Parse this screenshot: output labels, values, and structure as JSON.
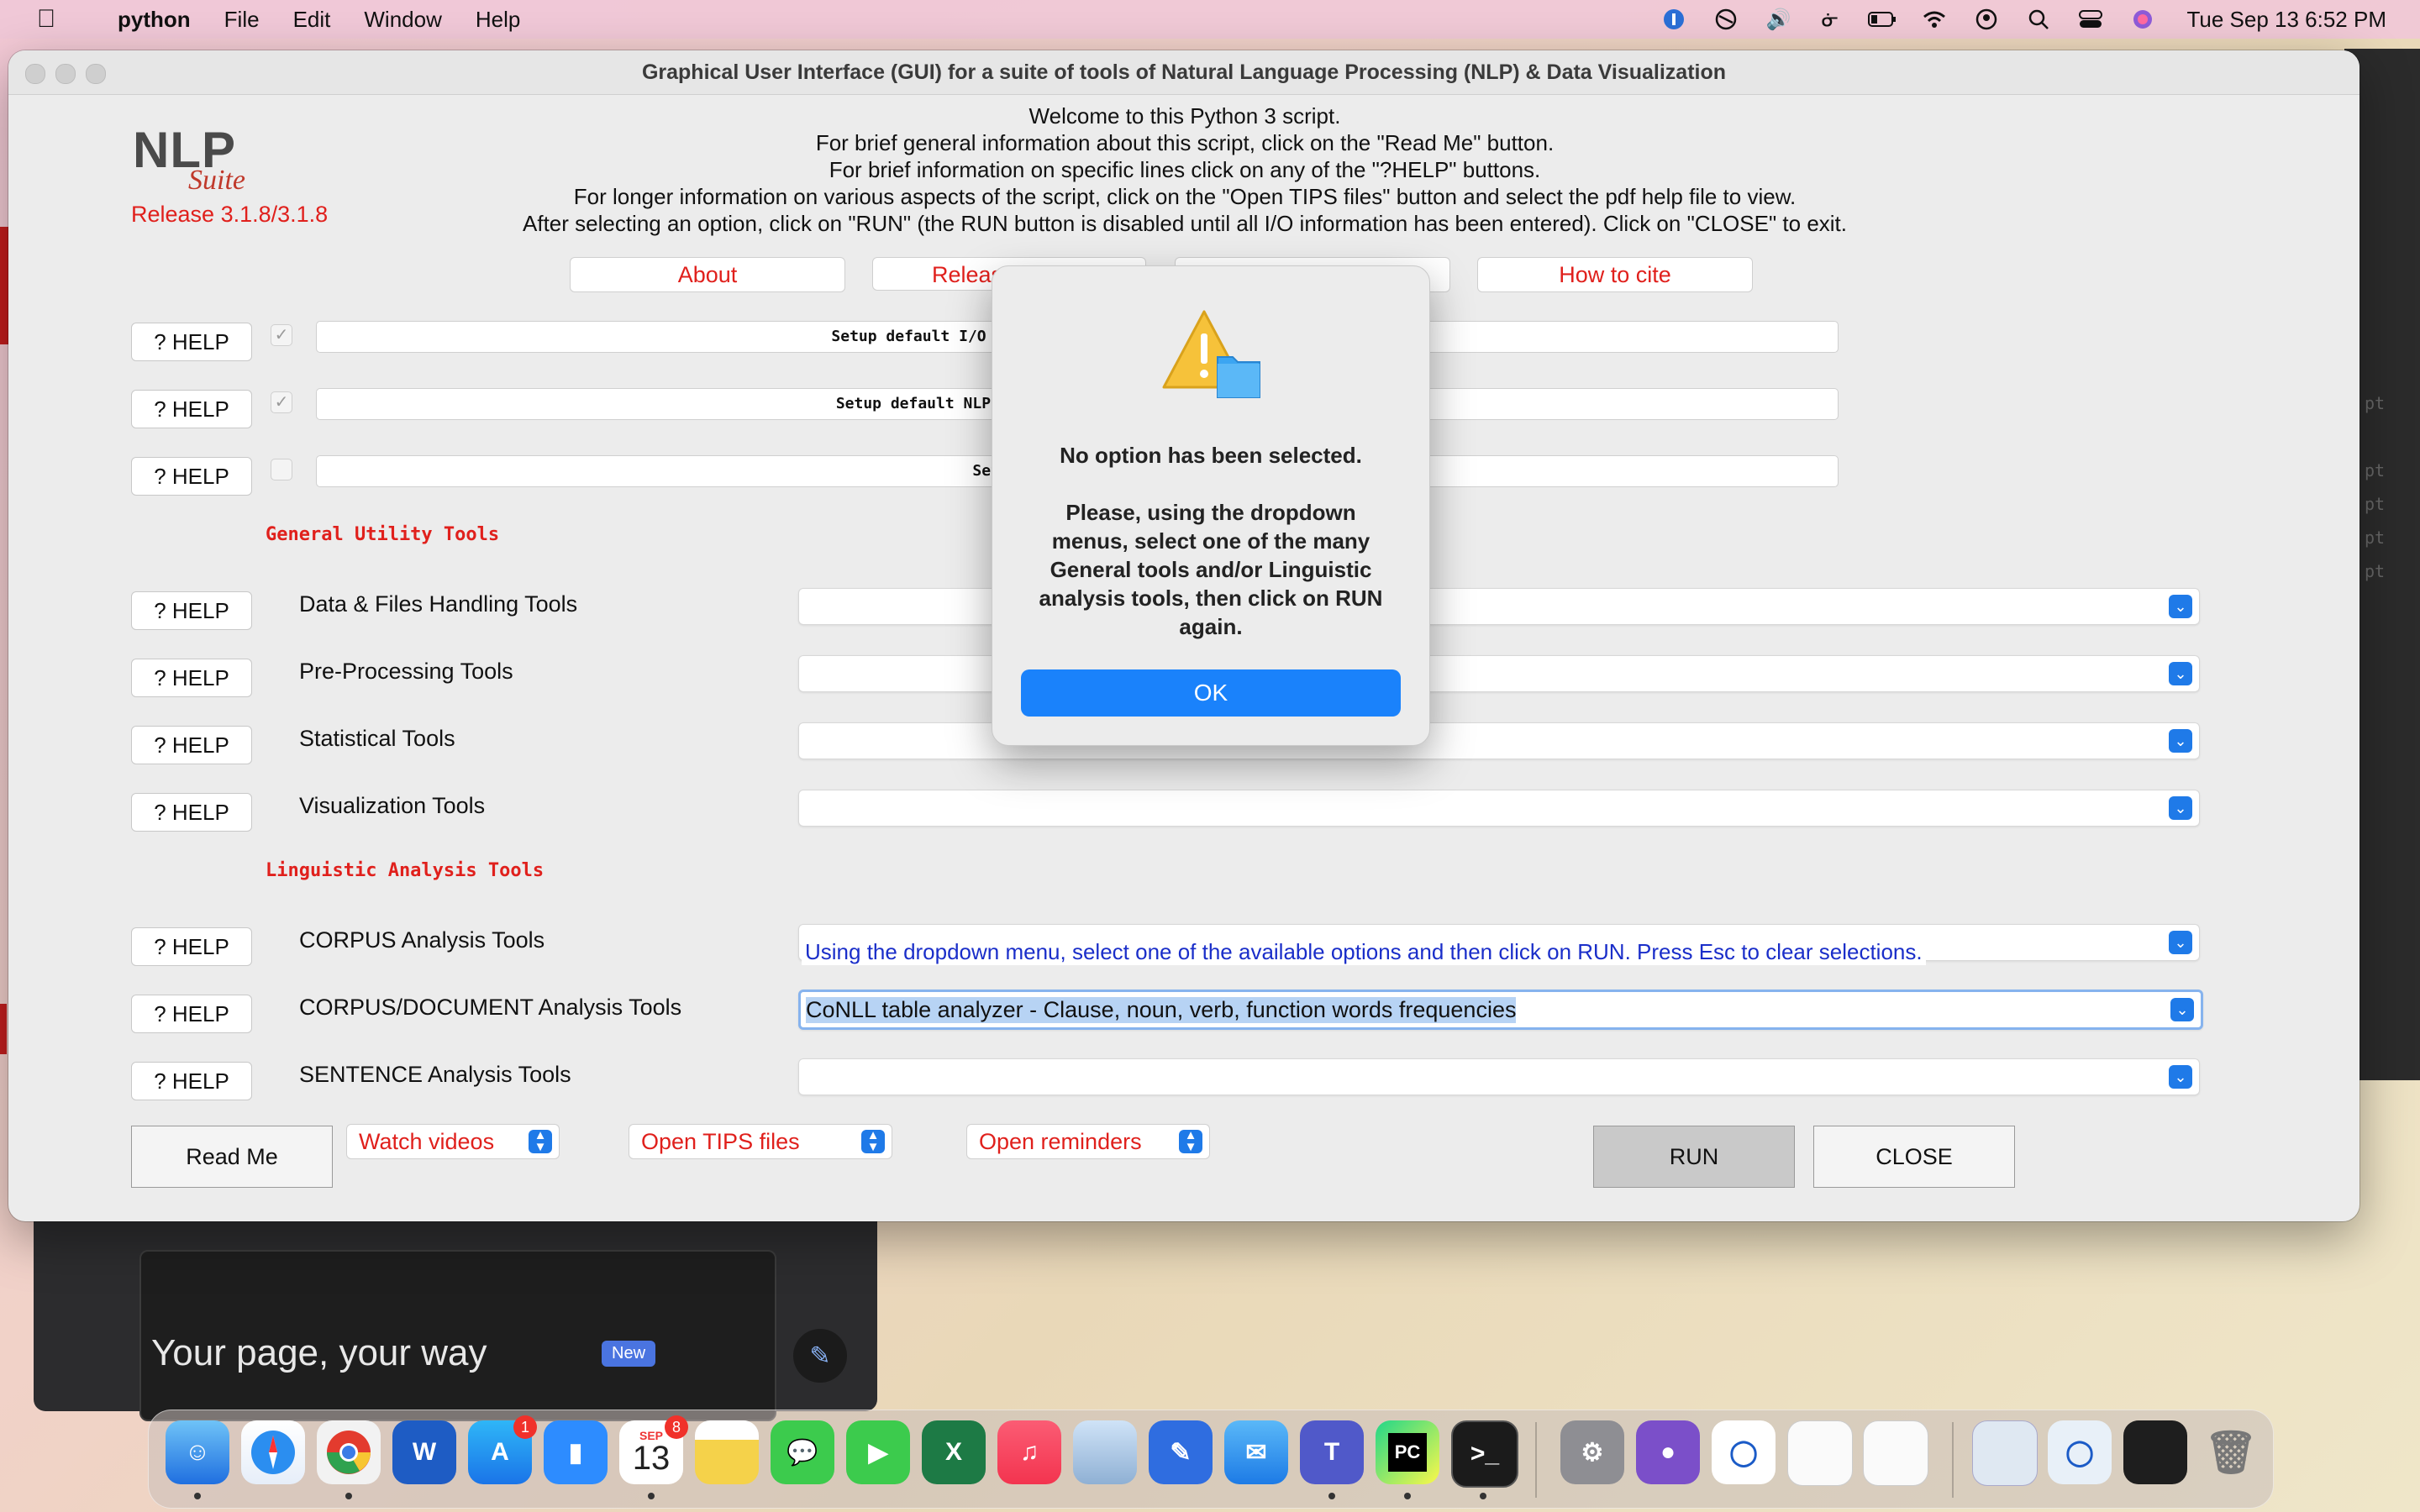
{
  "menubar": {
    "app": "python",
    "items": [
      "File",
      "Edit",
      "Window",
      "Help"
    ],
    "clock": "Tue Sep 13  6:52 PM"
  },
  "window": {
    "title": "Graphical User Interface (GUI) for a suite of tools of Natural Language Processing (NLP) & Data Visualization"
  },
  "logo": {
    "nlp": "NLP",
    "suite": "Suite",
    "release": "Release 3.1.8/3.1.8"
  },
  "welcome": [
    "Welcome to this Python 3 script.",
    "For brief general information about this script, click on the \"Read Me\" button.",
    "For brief information on specific lines click on any of the \"?HELP\" buttons.",
    "For longer information on various aspects of the script, click on the \"Open TIPS files\" button and select the pdf help file to view.",
    "After selecting an option, click on \"RUN\" (the RUN button is disabled until all I/O information has been entered).   Click on \"CLOSE\" to exit."
  ],
  "top_buttons": {
    "about": "About",
    "release": "Releas",
    "cite": "How to cite"
  },
  "help_label": "? HELP",
  "setup_rows": [
    {
      "label": "Setup default I/O options: INPUT corpus file(s) and OU",
      "checked": true
    },
    {
      "label": "Setup default NLP parser & annotators package and def",
      "checked": true
    },
    {
      "label": "Setup external software",
      "checked": false
    }
  ],
  "sections": {
    "general": "General Utility Tools",
    "linguistic": "Linguistic Analysis Tools"
  },
  "tool_rows": [
    {
      "label": "Data & Files Handling Tools",
      "value": ""
    },
    {
      "label": "Pre-Processing Tools",
      "value": ""
    },
    {
      "label": "Statistical Tools",
      "value": ""
    },
    {
      "label": "Visualization Tools",
      "value": ""
    },
    {
      "label": "CORPUS Analysis Tools",
      "value": ""
    },
    {
      "label": "CORPUS/DOCUMENT Analysis Tools",
      "value": "CoNLL table analyzer - Clause, noun, verb, function words frequencies"
    },
    {
      "label": "SENTENCE Analysis Tools",
      "value": ""
    }
  ],
  "hint": "Using the dropdown menu, select one of the available options and then click on RUN. Press Esc to clear selections.",
  "bottom": {
    "read_me": "Read Me",
    "watch_videos": "Watch videos",
    "open_tips": "Open TIPS files",
    "open_reminders": "Open reminders",
    "run": "RUN",
    "close": "CLOSE"
  },
  "alert": {
    "title": "No option has been selected.",
    "body": "Please, using the dropdown menus, select one of the many General tools and/or Linguistic analysis tools, then click on RUN again.",
    "ok": "OK"
  },
  "background": {
    "headline": "Your page, your way",
    "badge": "New",
    "terminal_text": [
      "pt",
      "pt",
      "pt",
      "pt",
      "pt"
    ]
  },
  "dock": {
    "app_store_badge": "1",
    "calendar_month": "SEP",
    "calendar_day": "13",
    "calendar_badge": "8",
    "pycharm": "PC"
  },
  "colors": {
    "accent_red": "#e0201c",
    "accent_blue": "#1a82fb",
    "hint_blue": "#1a2ec9"
  }
}
